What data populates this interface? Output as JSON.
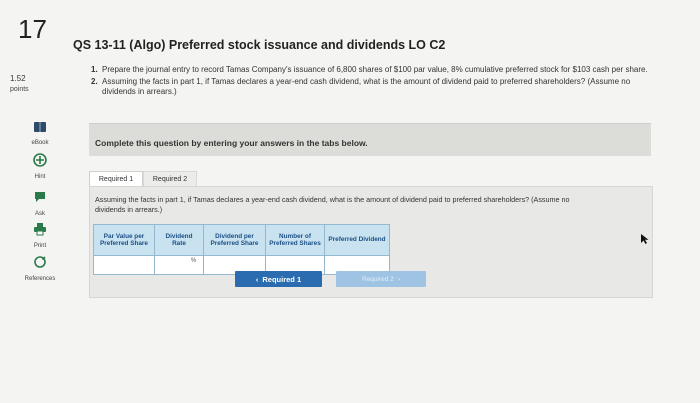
{
  "question": {
    "number": "17",
    "points_value": "1.52",
    "points_label": "points",
    "title": "QS 13-11 (Algo) Preferred stock issuance and dividends LO C2",
    "items": [
      {
        "num": "1.",
        "text": "Prepare the journal entry to record Tamas Company's issuance of 6,800 shares of $100 par value, 8% cumulative preferred stock for $103 cash per share."
      },
      {
        "num": "2.",
        "text": "Assuming the facts in part 1, if Tamas declares a year-end cash dividend, what is the amount of dividend paid to preferred shareholders? (Assume no dividends in arrears.)"
      }
    ]
  },
  "sidebar": {
    "tools": [
      {
        "label": "eBook",
        "icon": "book-icon"
      },
      {
        "label": "Hint",
        "icon": "hint-icon"
      },
      {
        "label": "Ask",
        "icon": "ask-icon"
      },
      {
        "label": "Print",
        "icon": "print-icon"
      },
      {
        "label": "References",
        "icon": "references-icon"
      }
    ]
  },
  "instruction_band": "Complete this question by entering your answers in the tabs below.",
  "tabs": [
    {
      "label": "Required 1"
    },
    {
      "label": "Required 2"
    }
  ],
  "active_tab_question": "Assuming the facts in part 1, if Tamas declares a year-end cash dividend, what is the amount of dividend paid to preferred shareholders? (Assume no dividends in arrears.)",
  "grid": {
    "headers": [
      "Par Value per Preferred Share",
      "Dividend Rate",
      "Dividend per Preferred Share",
      "Number of Preferred Shares",
      "Preferred Dividend"
    ],
    "percent_symbol": "%"
  },
  "nav": {
    "prev_label": "Required 1",
    "next_label": "Required 2",
    "prev_arrow": "‹",
    "next_arrow": "›"
  },
  "colors": {
    "accent": "#2b6cb0",
    "header_bg": "#c8e2f0",
    "header_text": "#1b4f86"
  }
}
